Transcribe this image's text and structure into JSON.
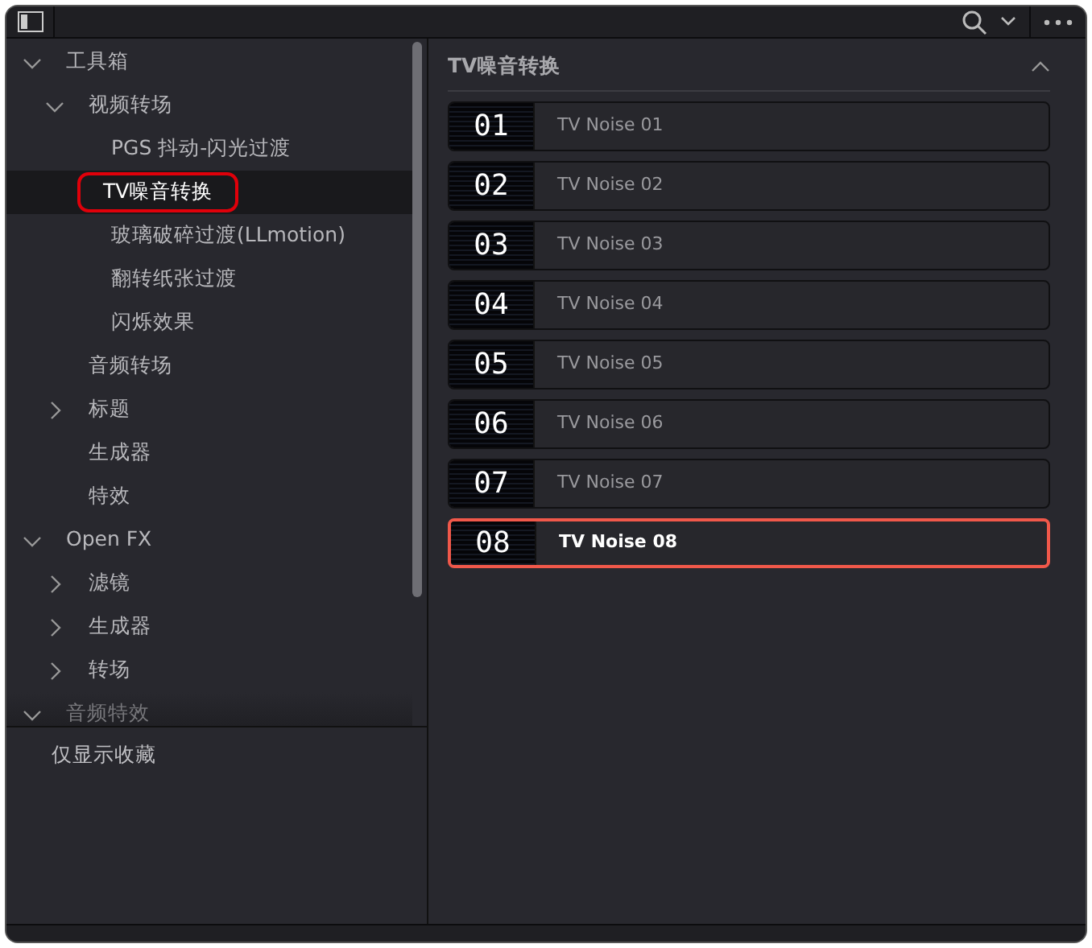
{
  "sidebar": {
    "tree": [
      {
        "label": "工具箱",
        "expanded": true,
        "selected": false,
        "children": [
          {
            "label": "视频转场",
            "expanded": true,
            "selected": false,
            "children": [
              {
                "label": "PGS 抖动-闪光过渡",
                "selected": false
              },
              {
                "label": "TV噪音转换",
                "selected": true
              },
              {
                "label": "玻璃破碎过渡(LLmotion)",
                "selected": false
              },
              {
                "label": "翻转纸张过渡",
                "selected": false
              },
              {
                "label": "闪烁效果",
                "selected": false
              }
            ]
          },
          {
            "label": "音频转场",
            "selected": false
          },
          {
            "label": "标题",
            "expanded": false,
            "selected": false
          },
          {
            "label": "生成器",
            "selected": false
          },
          {
            "label": "特效",
            "selected": false
          }
        ]
      },
      {
        "label": "Open FX",
        "expanded": true,
        "selected": false,
        "children": [
          {
            "label": "滤镜",
            "expanded": false,
            "selected": false
          },
          {
            "label": "生成器",
            "expanded": false,
            "selected": false
          },
          {
            "label": "转场",
            "expanded": false,
            "selected": false
          }
        ]
      },
      {
        "label": "音频特效",
        "expanded": true,
        "selected": false
      }
    ],
    "favorites_label": "仅显示收藏"
  },
  "content": {
    "title": "TV噪音转换",
    "expanded": true,
    "items": [
      {
        "number": "01",
        "label": "TV Noise 01",
        "selected": false
      },
      {
        "number": "02",
        "label": "TV Noise 02",
        "selected": false
      },
      {
        "number": "03",
        "label": "TV Noise 03",
        "selected": false
      },
      {
        "number": "04",
        "label": "TV Noise 04",
        "selected": false
      },
      {
        "number": "05",
        "label": "TV Noise 05",
        "selected": false
      },
      {
        "number": "06",
        "label": "TV Noise 06",
        "selected": false
      },
      {
        "number": "07",
        "label": "TV Noise 07",
        "selected": false
      },
      {
        "number": "08",
        "label": "TV Noise 08",
        "selected": true
      }
    ]
  }
}
